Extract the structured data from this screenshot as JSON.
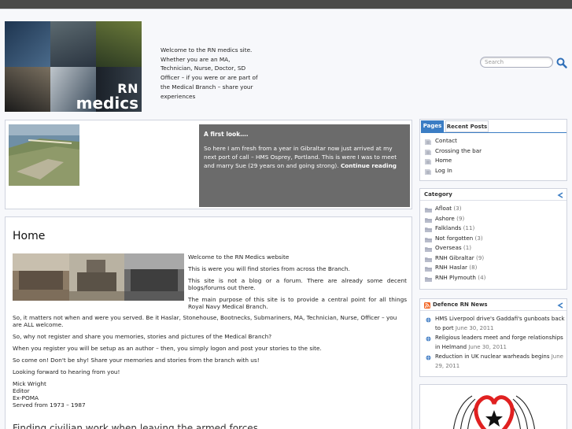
{
  "header": {
    "logo_line1": "RN",
    "logo_line2": "medics",
    "welcome": "Welcome to the RN medics site. Whether you are an MA, Technician, Nurse, Doctor, SD Officer – if you were or are part of the Medical Branch – share your experiences",
    "search_placeholder": "Search"
  },
  "featured": {
    "title": "A first look….",
    "body": "So here I am fresh from a year in Gibraltar now just arrived at my next port of call – HMS Osprey, Portland. This is were I was to meet and marry Sue (29 years on and going strong).",
    "more": "Continue reading"
  },
  "content": {
    "heading": "Home",
    "p1": "Welcome to the RN Medics website",
    "p2": "This is were you will find stories from across the Branch.",
    "p3": "This site is not a blog or a forum. There are already some decent blogs/forums out there.",
    "p4": "The main purpose of this site is to provide a central point for all things Royal Navy Medical Branch.",
    "p5": "So, it matters not when and were you served. Be it Haslar, Stonehouse, Bootnecks, Submariners, MA, Technician, Nurse, Officer – you are ALL welcome.",
    "p6": "So, why not register and share you memories, stories and pictures of the Medical Branch?",
    "p7": "When you register you will be setup as an author – then, you simply logon and post your stories to the site.",
    "p8": "So come on! Don't be shy! Share your memories and stories from the branch with us!",
    "p9": "Looking forward to hearing from you!",
    "sig1": "Mick Wright",
    "sig2": "Editor",
    "sig3": "Ex-POMA",
    "sig4": "Served from 1973 – 1987",
    "next_title": "Finding civilian work when leaving the armed forces"
  },
  "sidebar": {
    "tabs": {
      "pages": "Pages",
      "recent": "Recent Posts"
    },
    "pages": [
      "Contact",
      "Crossing the bar",
      "Home",
      "Log In"
    ],
    "category_title": "Category",
    "categories": [
      {
        "name": "Afloat",
        "count": "(3)"
      },
      {
        "name": "Ashore",
        "count": "(9)"
      },
      {
        "name": "Falklands",
        "count": "(11)"
      },
      {
        "name": "Not forgotten",
        "count": "(3)"
      },
      {
        "name": "Overseas",
        "count": "(1)"
      },
      {
        "name": "RNH Gibraltar",
        "count": "(9)"
      },
      {
        "name": "RNH Haslar",
        "count": "(8)"
      },
      {
        "name": "RNH Plymouth",
        "count": "(4)"
      }
    ],
    "news_title": "Defence RN News",
    "news": [
      {
        "title": "HMS Liverpool drive's Gaddafi's gunboats back to port",
        "date": "June 30, 2011"
      },
      {
        "title": "Religious leaders meet and forge relationships in Helmand",
        "date": "June 30, 2011"
      },
      {
        "title": "Reduction in UK nuclear warheads begins",
        "date": "June 29, 2011"
      }
    ]
  },
  "colors": {
    "accent": "#3b7dc4",
    "panel": "#6b6b6b",
    "rss": "#f26522",
    "heart": "#e02020"
  }
}
